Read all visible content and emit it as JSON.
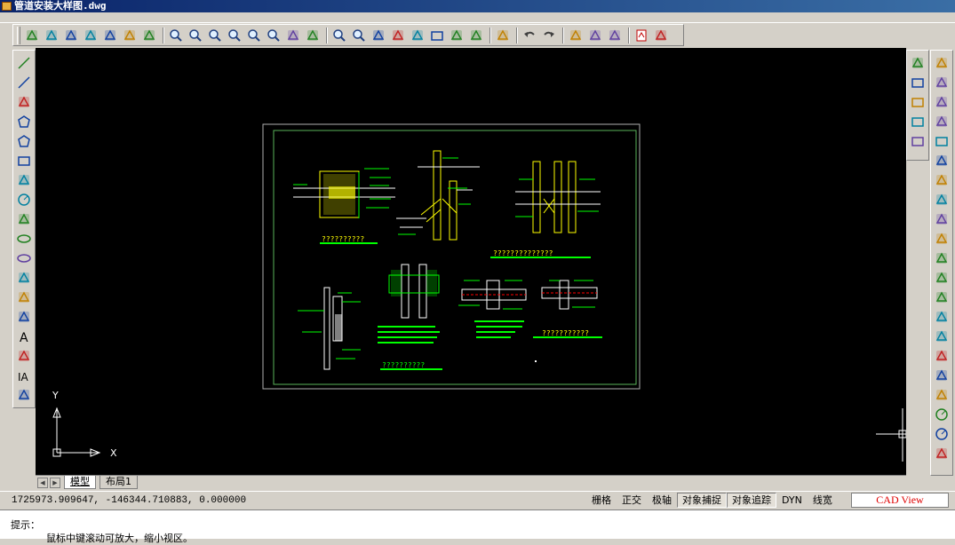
{
  "window": {
    "title": "管道安装大样图.dwg"
  },
  "toolbar": {
    "top_icons": [
      "new-file-icon",
      "open-file-icon",
      "open-folder-icon",
      "recent-icon",
      "save-icon",
      "cut-icon",
      "copy-icon",
      "zoom-window-icon",
      "zoom-realtime-icon",
      "zoom-extents-icon",
      "zoom-all-icon",
      "zoom-previous-icon",
      "zoom-scale-icon",
      "light-icon",
      "brush-icon",
      "zoom-in-icon",
      "zoom-out-icon",
      "pan-icon",
      "pen-icon",
      "paint-icon",
      "layers-icon",
      "pencil-icon",
      "properties-icon",
      "erase-icon",
      "undo-icon",
      "redo-icon",
      "print-icon",
      "render-icon",
      "publish-icon",
      "pdf-icon",
      "image-icon"
    ],
    "left_icons": [
      "line-icon",
      "xline-icon",
      "polyline-icon",
      "polygon-icon",
      "hexagon-icon",
      "rectangle-icon",
      "arc-icon",
      "circle-icon",
      "spline-icon",
      "ellipse-icon",
      "ellipse-arc-icon",
      "point-icon",
      "insert-block-icon",
      "make-block-icon",
      "text-icon",
      "hatch-icon",
      "mtext-icon",
      "table-icon"
    ],
    "right_icons_a": [
      "dim-style-icon",
      "layer-prev-icon",
      "layer-copy-icon",
      "layer-move-icon",
      "layer-send-icon"
    ],
    "right_icons_b": [
      "pencil-edit-icon",
      "copy-object-icon",
      "move-icon",
      "rotate-icon",
      "region-icon",
      "offset-icon",
      "array-icon",
      "mirror-icon",
      "stretch-icon",
      "trim-icon",
      "fillet-icon",
      "break-icon",
      "extend-icon",
      "explode-icon",
      "chamfer-icon",
      "join-icon",
      "dim-linear-icon",
      "dim-aligned-icon",
      "dim-radius-icon",
      "dim-diameter-icon",
      "dim-angular-icon"
    ]
  },
  "drawing": {
    "labels_row1": [
      "??????????",
      "??????????????",
      "???????????"
    ],
    "labels_row2": [
      "??????????",
      "??????????????",
      "??????????"
    ]
  },
  "axes": {
    "y_label": "Y",
    "x_label": "X"
  },
  "tabs": [
    {
      "label": "模型",
      "active": true
    },
    {
      "label": "布局1",
      "active": false
    }
  ],
  "status": {
    "coords": "1725973.909647,  -146344.710883,  0.000000",
    "modes": [
      {
        "label": "栅格",
        "on": false
      },
      {
        "label": "正交",
        "on": false
      },
      {
        "label": "极轴",
        "on": false
      },
      {
        "label": "对象捕捉",
        "on": true
      },
      {
        "label": "对象追踪",
        "on": true
      },
      {
        "label": "DYN",
        "on": false
      },
      {
        "label": "线宽",
        "on": false
      }
    ],
    "cad_view": "CAD View"
  },
  "command": {
    "prompt": "提示：",
    "hint": "鼠标中键滚动可放大，缩小视区。"
  },
  "colors": {
    "canvas": "#000000",
    "frame": "#a0a0a0",
    "yellow": "#ffff00",
    "green": "#00ff00",
    "white": "#ffffff",
    "red": "#ff0000"
  }
}
